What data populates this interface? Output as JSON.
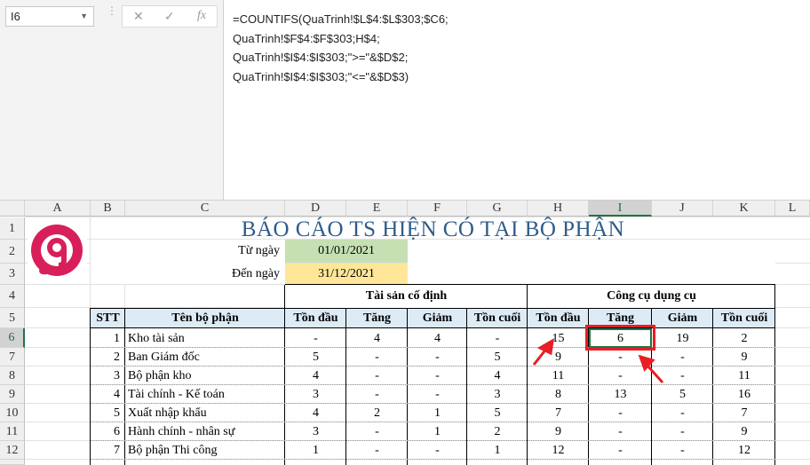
{
  "name_box": "I6",
  "fx_label": "fx",
  "formula_lines": [
    "=COUNTIFS(QuaTrinh!$L$4:$L$303;$C6;",
    "QuaTrinh!$F$4:$F$303;H$4;",
    "QuaTrinh!$I$4:$I$303;\">=\"&$D$2;",
    "QuaTrinh!$I$4:$I$303;\"<=\"&$D$3)"
  ],
  "columns": [
    "A",
    "B",
    "C",
    "D",
    "E",
    "F",
    "G",
    "H",
    "I",
    "J",
    "K",
    "L"
  ],
  "rows": [
    "1",
    "2",
    "3",
    "4",
    "5",
    "6",
    "7",
    "8",
    "9",
    "10",
    "11",
    "12"
  ],
  "report": {
    "title": "BÁO CÁO TS HIỆN CÓ TẠI BỘ PHẬN",
    "from_label": "Từ ngày",
    "from_value": "01/01/2021",
    "to_label": "Đến ngày",
    "to_value": "31/12/2021",
    "group1": "Tài sản cố định",
    "group2": "Công cụ dụng cụ",
    "headers": [
      "STT",
      "Tên bộ phận",
      "Tồn đầu",
      "Tăng",
      "Giảm",
      "Tồn cuối",
      "Tồn đầu",
      "Tăng",
      "Giảm",
      "Tồn cuối"
    ],
    "data_rows": [
      [
        "1",
        "Kho tài sản",
        "-",
        "4",
        "4",
        "-",
        "15",
        "6",
        "19",
        "2"
      ],
      [
        "2",
        "Ban Giám đốc",
        "5",
        "-",
        "-",
        "5",
        "9",
        "-",
        "-",
        "9"
      ],
      [
        "3",
        "Bộ phận kho",
        "4",
        "-",
        "-",
        "4",
        "11",
        "-",
        "-",
        "11"
      ],
      [
        "4",
        "Tài chính - Kế toán",
        "3",
        "-",
        "-",
        "3",
        "8",
        "13",
        "5",
        "16"
      ],
      [
        "5",
        "Xuất nhập khẩu",
        "4",
        "2",
        "1",
        "5",
        "7",
        "-",
        "-",
        "7"
      ],
      [
        "6",
        "Hành chính - nhân sự",
        "3",
        "-",
        "1",
        "2",
        "9",
        "-",
        "-",
        "9"
      ],
      [
        "7",
        "Bộ phận Thi công",
        "1",
        "-",
        "-",
        "1",
        "12",
        "-",
        "-",
        "12"
      ]
    ]
  },
  "colors": {
    "logo": "#d81f5a",
    "from_fill": "#c6e0b4",
    "to_fill": "#ffe699",
    "header_fill": "#ddebf7",
    "highlight": "#e81e25",
    "selection": "#217346"
  }
}
